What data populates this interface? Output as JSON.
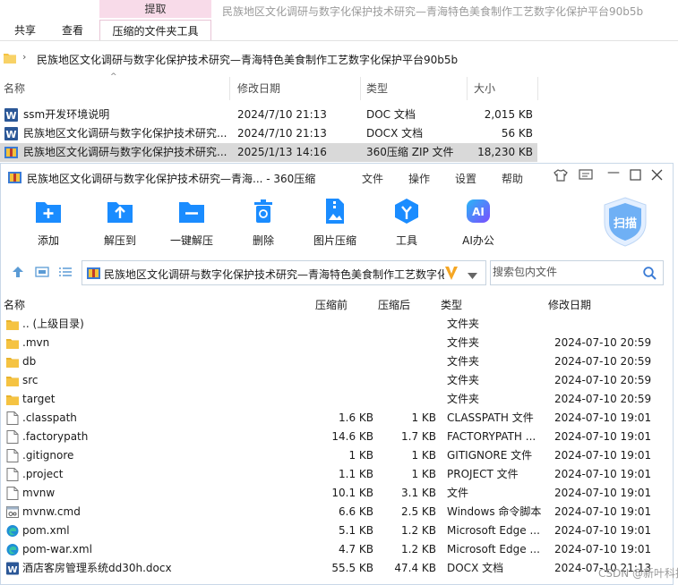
{
  "explorer": {
    "context_group": "提取",
    "title": "民族地区文化调研与数字化保护技术研究—青海特色美食制作工艺数字化保护平台90b5b",
    "tabs": [
      "共享",
      "查看",
      "压缩的文件夹工具"
    ],
    "path": "民族地区文化调研与数字化保护技术研究—青海特色美食制作工艺数字化保护平台90b5b",
    "columns": [
      "名称",
      "修改日期",
      "类型",
      "大小"
    ],
    "rows": [
      {
        "name": "ssm开发环境说明",
        "date": "2024/7/10 21:13",
        "type": "DOC 文档",
        "size": "2,015 KB",
        "icon": "word-icon"
      },
      {
        "name": "民族地区文化调研与数字化保护技术研究...",
        "date": "2024/7/10 21:13",
        "type": "DOCX 文档",
        "size": "56 KB",
        "icon": "word-icon"
      },
      {
        "name": "民族地区文化调研与数字化保护技术研究...",
        "date": "2025/1/13 14:16",
        "type": "360压缩 ZIP 文件",
        "size": "18,230 KB",
        "icon": "zip-icon"
      }
    ]
  },
  "app": {
    "title": "民族地区文化调研与数字化保护技术研究—青海... - 360压缩",
    "menu": [
      "文件",
      "操作",
      "设置",
      "帮助"
    ],
    "toolbar": [
      {
        "label": "添加",
        "icon": "add-icon"
      },
      {
        "label": "解压到",
        "icon": "extract-to-icon"
      },
      {
        "label": "一键解压",
        "icon": "one-click-extract-icon"
      },
      {
        "label": "删除",
        "icon": "delete-icon"
      },
      {
        "label": "图片压缩",
        "icon": "image-compress-icon"
      },
      {
        "label": "工具",
        "icon": "tools-icon"
      },
      {
        "label": "AI办公",
        "icon": "ai-office-icon"
      }
    ],
    "scan_label": "扫描",
    "path": "民族地区文化调研与数字化保护技术研究—青海特色美食制作工艺数字化保护平台90b5b",
    "search_placeholder": "搜索包内文件",
    "columns": [
      "名称",
      "压缩前",
      "压缩后",
      "类型",
      "修改日期"
    ],
    "files": [
      {
        "name": ".. (上级目录)",
        "before": "",
        "after": "",
        "type": "文件夹",
        "date": "",
        "icon": "folder"
      },
      {
        "name": ".mvn",
        "before": "",
        "after": "",
        "type": "文件夹",
        "date": "2024-07-10 20:59",
        "icon": "folder"
      },
      {
        "name": "db",
        "before": "",
        "after": "",
        "type": "文件夹",
        "date": "2024-07-10 20:59",
        "icon": "folder"
      },
      {
        "name": "src",
        "before": "",
        "after": "",
        "type": "文件夹",
        "date": "2024-07-10 20:59",
        "icon": "folder"
      },
      {
        "name": "target",
        "before": "",
        "after": "",
        "type": "文件夹",
        "date": "2024-07-10 20:59",
        "icon": "folder"
      },
      {
        "name": ".classpath",
        "before": "1.6 KB",
        "after": "1 KB",
        "type": "CLASSPATH 文件",
        "date": "2024-07-10 19:01",
        "icon": "file"
      },
      {
        "name": ".factorypath",
        "before": "14.6 KB",
        "after": "1.7 KB",
        "type": "FACTORYPATH ...",
        "date": "2024-07-10 19:01",
        "icon": "file"
      },
      {
        "name": ".gitignore",
        "before": "1 KB",
        "after": "1 KB",
        "type": "GITIGNORE 文件",
        "date": "2024-07-10 19:01",
        "icon": "file"
      },
      {
        "name": ".project",
        "before": "1.1 KB",
        "after": "1 KB",
        "type": "PROJECT 文件",
        "date": "2024-07-10 19:01",
        "icon": "file"
      },
      {
        "name": "mvnw",
        "before": "10.1 KB",
        "after": "3.1 KB",
        "type": "文件",
        "date": "2024-07-10 19:01",
        "icon": "file"
      },
      {
        "name": "mvnw.cmd",
        "before": "6.6 KB",
        "after": "2.5 KB",
        "type": "Windows 命令脚本",
        "date": "2024-07-10 19:01",
        "icon": "cmd"
      },
      {
        "name": "pom.xml",
        "before": "5.1 KB",
        "after": "1.2 KB",
        "type": "Microsoft Edge ...",
        "date": "2024-07-10 19:01",
        "icon": "edge"
      },
      {
        "name": "pom-war.xml",
        "before": "4.7 KB",
        "after": "1.2 KB",
        "type": "Microsoft Edge ...",
        "date": "2024-07-10 19:01",
        "icon": "edge"
      },
      {
        "name": "酒店客房管理系统dd30h.docx",
        "before": "55.5 KB",
        "after": "47.4 KB",
        "type": "DOCX 文档",
        "date": "2024-07-10 21:13",
        "icon": "word"
      }
    ]
  },
  "watermark": "CSDN @新叶科技",
  "colors": {
    "accent": "#1a8cff",
    "selection": "#d9d9d9",
    "context_tab": "#f8dbe9",
    "folder": "#f5c342",
    "word": "#2b5797"
  }
}
